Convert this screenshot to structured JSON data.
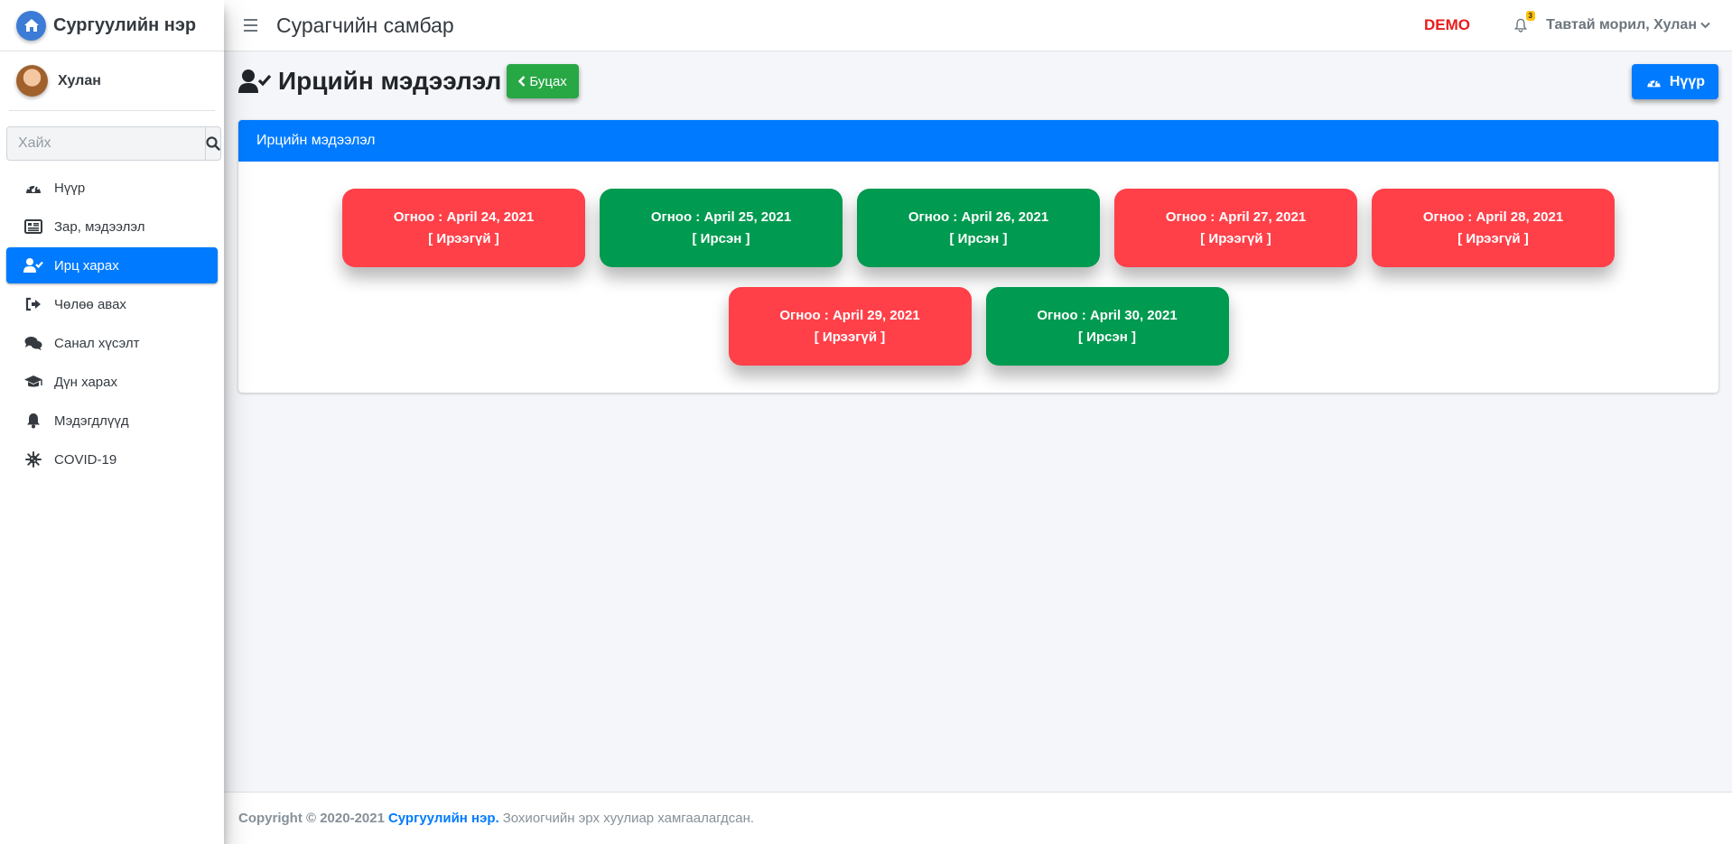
{
  "brand": {
    "name": "Сургуулийн нэр"
  },
  "user": {
    "name": "Хулан"
  },
  "search": {
    "placeholder": "Хайх"
  },
  "sidebar": {
    "items": [
      {
        "label": "Нүүр",
        "icon": "gauge-icon"
      },
      {
        "label": "Зар, мэдээлэл",
        "icon": "news-icon"
      },
      {
        "label": "Ирц харах",
        "icon": "user-check-icon",
        "active": true
      },
      {
        "label": "Чөлөө авах",
        "icon": "sign-out-icon"
      },
      {
        "label": "Санал хүсэлт",
        "icon": "comments-icon"
      },
      {
        "label": "Дүн харах",
        "icon": "graduation-cap-icon"
      },
      {
        "label": "Мэдэгдлүүд",
        "icon": "bell-icon"
      },
      {
        "label": "COVID-19",
        "icon": "virus-icon"
      }
    ]
  },
  "topbar": {
    "title": "Сурагчийн самбар",
    "demo": "DEMO",
    "notification_count": "3",
    "welcome": "Тавтай морил, Хулан"
  },
  "page": {
    "title": "Ирцийн мэдээлэл",
    "back_label": "Буцах",
    "home_label": "Нүүр"
  },
  "card": {
    "header": "Ирцийн мэдээлэл",
    "days": [
      {
        "date": "Огноо : April 24, 2021",
        "status": "[ Ирээгүй ]",
        "present": false
      },
      {
        "date": "Огноо : April 25, 2021",
        "status": "[ Ирсэн ]",
        "present": true
      },
      {
        "date": "Огноо : April 26, 2021",
        "status": "[ Ирсэн ]",
        "present": true
      },
      {
        "date": "Огноо : April 27, 2021",
        "status": "[ Ирээгүй ]",
        "present": false
      },
      {
        "date": "Огноо : April 28, 2021",
        "status": "[ Ирээгүй ]",
        "present": false
      },
      {
        "date": "Огноо : April 29, 2021",
        "status": "[ Ирээгүй ]",
        "present": false
      },
      {
        "date": "Огноо : April 30, 2021",
        "status": "[ Ирсэн ]",
        "present": true
      }
    ]
  },
  "footer": {
    "copyright": "Copyright © 2020-2021",
    "school": "Сургуулийн нэр.",
    "rights": "Зохиогчийн эрх хуулиар хамгаалагдсан."
  },
  "colors": {
    "primary": "#007bff",
    "present": "#009a50",
    "absent": "#ff4049",
    "back_button": "#28a745",
    "demo": "#e81c1c"
  }
}
